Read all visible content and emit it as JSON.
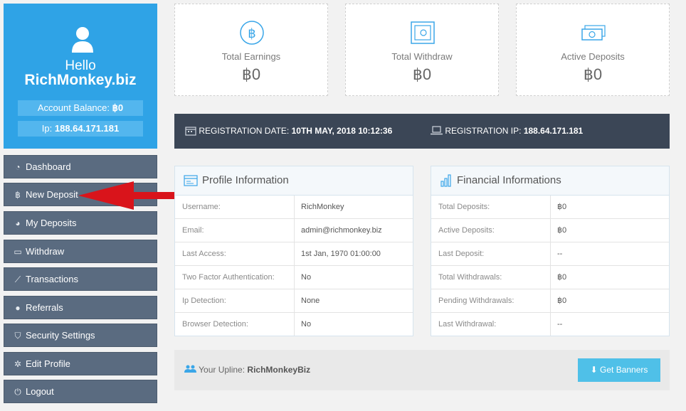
{
  "user": {
    "hello": "Hello",
    "name": "RichMonkey.biz",
    "balance_label": "Account Balance:",
    "balance_value": "฿0",
    "ip_label": "Ip:",
    "ip_value": "188.64.171.181"
  },
  "nav": [
    {
      "label": "Dashboard",
      "icon": "dashboard-icon"
    },
    {
      "label": "New Deposit",
      "icon": "bitcoin-icon"
    },
    {
      "label": "My Deposits",
      "icon": "pie-chart-icon"
    },
    {
      "label": "Withdraw",
      "icon": "credit-card-icon"
    },
    {
      "label": "Transactions",
      "icon": "line-chart-icon"
    },
    {
      "label": "Referrals",
      "icon": "users-icon"
    },
    {
      "label": "Security Settings",
      "icon": "shield-icon"
    },
    {
      "label": "Edit Profile",
      "icon": "gear-icon"
    },
    {
      "label": "Logout",
      "icon": "power-icon"
    }
  ],
  "stats": [
    {
      "label": "Total Earnings",
      "value": "฿0",
      "icon": "bitcoin-circle-icon"
    },
    {
      "label": "Total Withdraw",
      "value": "฿0",
      "icon": "safe-icon"
    },
    {
      "label": "Active Deposits",
      "value": "฿0",
      "icon": "banknote-icon"
    }
  ],
  "registration": {
    "date_label": "REGISTRATION DATE:",
    "date_value": "10TH MAY, 2018 10:12:36",
    "ip_label": "REGISTRATION IP:",
    "ip_value": "188.64.171.181"
  },
  "profile": {
    "title": "Profile Information",
    "rows": [
      {
        "key": "Username:",
        "value": "RichMonkey"
      },
      {
        "key": "Email:",
        "value": "admin@richmonkey.biz"
      },
      {
        "key": "Last Access:",
        "value": "1st Jan, 1970 01:00:00"
      },
      {
        "key": "Two Factor Authentication:",
        "value": "No"
      },
      {
        "key": "Ip Detection:",
        "value": "None"
      },
      {
        "key": "Browser Detection:",
        "value": "No"
      }
    ]
  },
  "financial": {
    "title": "Financial Informations",
    "rows": [
      {
        "key": "Total Deposits:",
        "value": "฿0"
      },
      {
        "key": "Active Deposits:",
        "value": "฿0"
      },
      {
        "key": "Last Deposit:",
        "value": "--"
      },
      {
        "key": "Total Withdrawals:",
        "value": "฿0"
      },
      {
        "key": "Pending Withdrawals:",
        "value": "฿0"
      },
      {
        "key": "Last Withdrawal:",
        "value": "--"
      }
    ]
  },
  "upline": {
    "label": "Your Upline:",
    "value": "RichMonkeyBiz"
  },
  "banners_button": "Get Banners",
  "colors": {
    "accent_blue": "#2fa3e6",
    "nav_bg": "#5a6b80",
    "regbar_bg": "#3b4656",
    "button_bg": "#4fc0e8",
    "annotation_arrow": "#d9141b"
  }
}
